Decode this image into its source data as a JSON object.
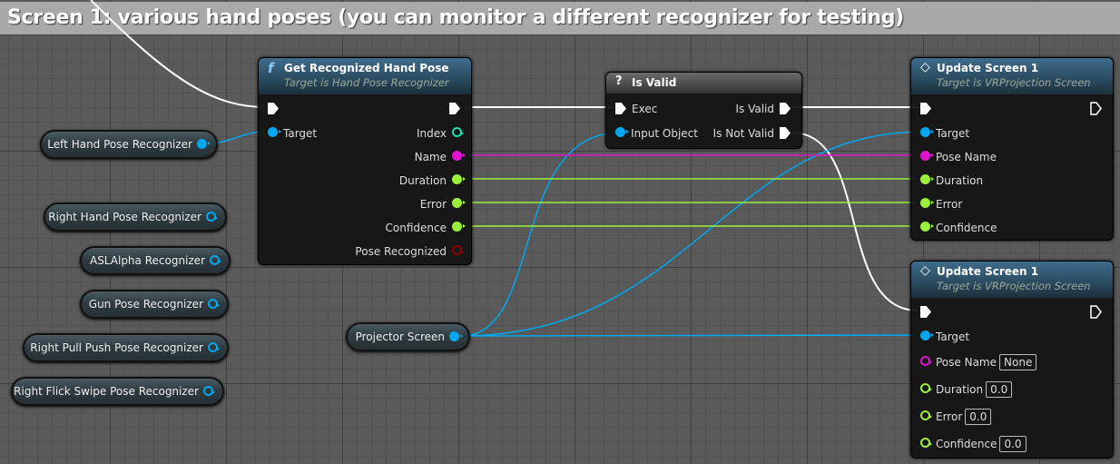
{
  "comment_banner": "Screen 1: various hand poses (you can monitor a different recognizer for testing)",
  "colors": {
    "object": "#00a8f0",
    "name": "#e014d0",
    "float": "#9cef3c",
    "bool": "#8c0000",
    "int": "#1fe0b0",
    "exec": "#ffffff"
  },
  "variables": [
    {
      "label": "Left Hand Pose Recognizer",
      "connected": true
    },
    {
      "label": "Right Hand Pose Recognizer",
      "connected": false
    },
    {
      "label": "ASLAlpha Recognizer",
      "connected": false
    },
    {
      "label": "Gun Pose Recognizer",
      "connected": false
    },
    {
      "label": "Right Pull Push Pose Recognizer",
      "connected": false
    },
    {
      "label": "Right Flick Swipe Pose Recognizer",
      "connected": false
    },
    {
      "label": "Projector Screen",
      "connected": true
    }
  ],
  "get_pose_node": {
    "icon": "function-icon",
    "icon_glyph": "f",
    "title": "Get Recognized Hand Pose",
    "subtitle": "Target is Hand Pose Recognizer",
    "inputs": [
      "Target"
    ],
    "outputs": [
      "Index",
      "Name",
      "Duration",
      "Error",
      "Confidence",
      "Pose Recognized"
    ]
  },
  "is_valid_node": {
    "icon_glyph": "?",
    "title": "Is Valid",
    "inputs": [
      "Exec",
      "Input Object"
    ],
    "outputs": [
      "Is Valid",
      "Is Not Valid"
    ]
  },
  "update1": {
    "icon_glyph": "◇",
    "title": "Update Screen 1",
    "subtitle": "Target is VRProjection Screen",
    "inputs": [
      "Target",
      "Pose Name",
      "Duration",
      "Error",
      "Confidence"
    ]
  },
  "update2": {
    "icon_glyph": "◇",
    "title": "Update Screen 1",
    "subtitle": "Target is VRProjection Screen",
    "inputs": [
      "Target",
      "Pose Name",
      "Duration",
      "Error",
      "Confidence"
    ],
    "defaults": [
      "None",
      "0.0",
      "0.0",
      "0.0"
    ]
  }
}
